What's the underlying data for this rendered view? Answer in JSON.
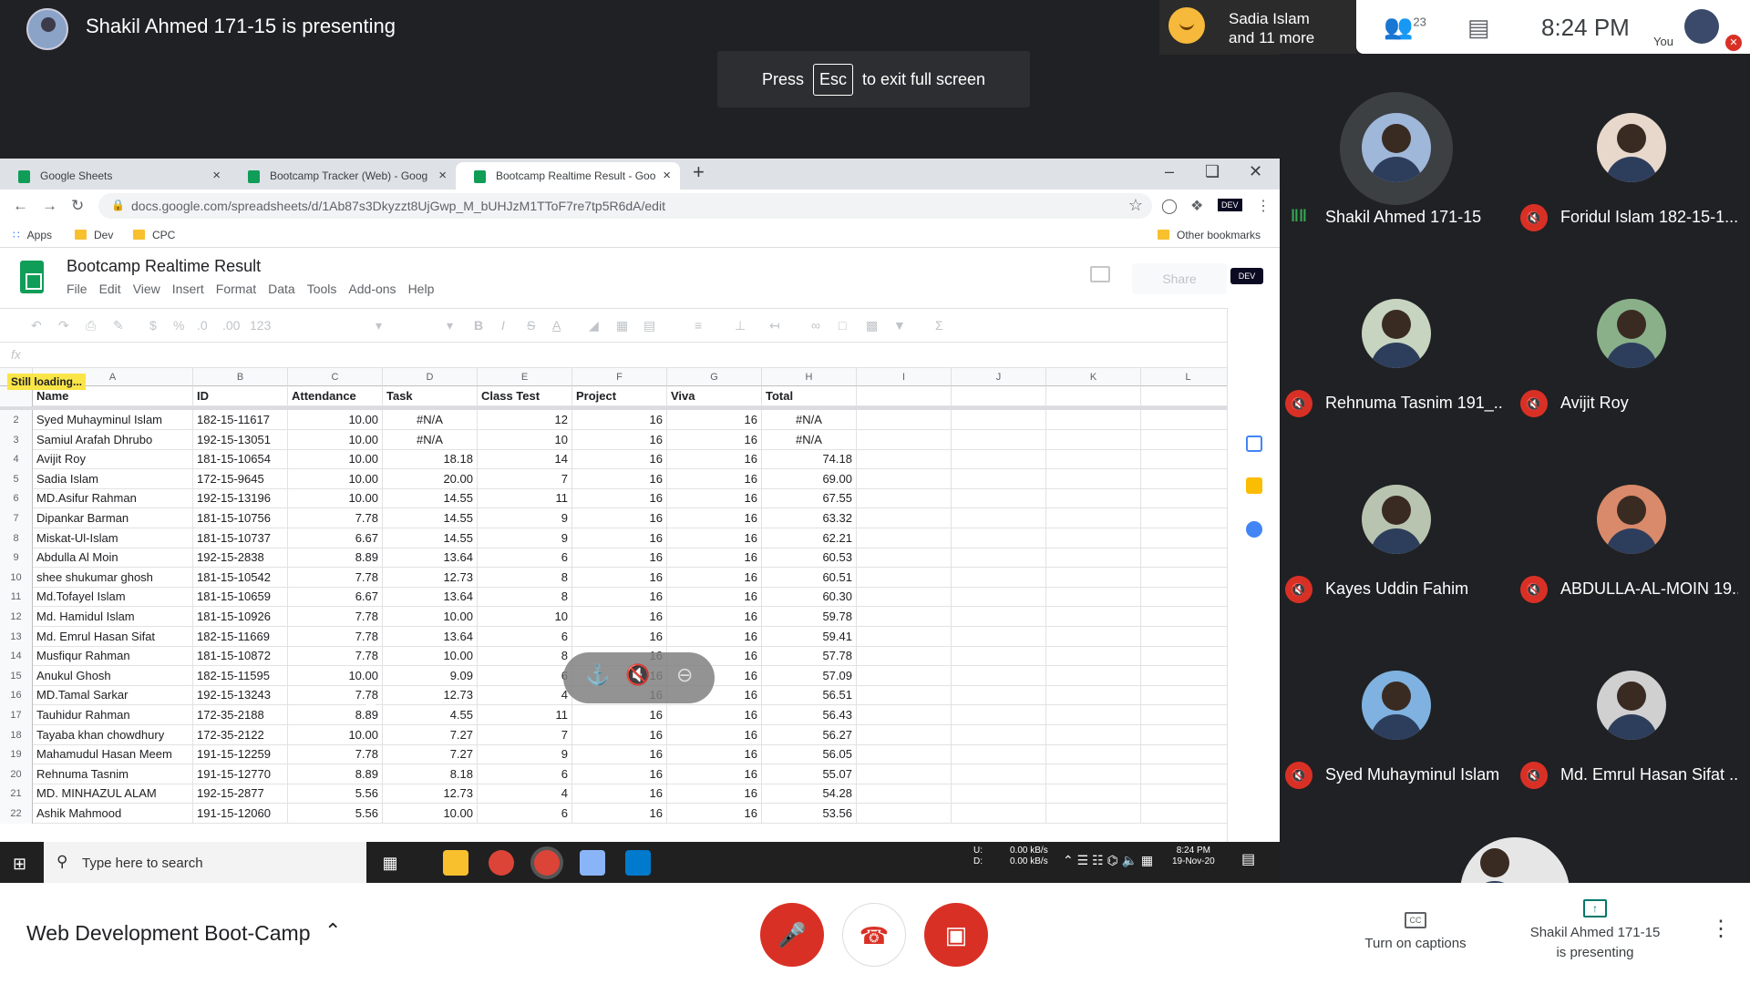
{
  "presenter": {
    "title": "Shakil Ahmed 171-15 is presenting"
  },
  "esc_toast": {
    "press": "Press",
    "key": "Esc",
    "suffix": "to exit full screen"
  },
  "speaker_pill": {
    "line1": "Sadia Islam",
    "line2": "and 11 more"
  },
  "meet_top": {
    "participant_count": "23",
    "clock": "8:24 PM",
    "you_label": "You"
  },
  "browser": {
    "tabs": [
      {
        "label": "Google Sheets"
      },
      {
        "label": "Bootcamp Tracker (Web) - Goog"
      },
      {
        "label": "Bootcamp Realtime Result - Goo"
      }
    ],
    "url": "docs.google.com/spreadsheets/d/1Ab87s3Dkyzzt8UjGwp_M_bUHJzM1TToF7re7tp5R6dA/edit",
    "bookmarks": [
      "Apps",
      "Dev",
      "CPC"
    ],
    "other_bookmarks": "Other bookmarks"
  },
  "sheet": {
    "title": "Bootcamp Realtime Result",
    "menu": [
      "File",
      "Edit",
      "View",
      "Insert",
      "Format",
      "Data",
      "Tools",
      "Add-ons",
      "Help"
    ],
    "share": "Share",
    "dev_badge": "DEV",
    "fx": "fx",
    "loading": "Still loading...",
    "toolbar_zoom": "123",
    "columns": [
      "A",
      "B",
      "C",
      "D",
      "E",
      "F",
      "G",
      "H",
      "I",
      "J",
      "K",
      "L"
    ],
    "headers": [
      "Name",
      "ID",
      "Attendance",
      "Task",
      "Class Test",
      "Project",
      "Viva",
      "Total"
    ],
    "rows": [
      [
        "2",
        "Syed Muhayminul Islam",
        "182-15-11617",
        "10.00",
        "#N/A",
        "12",
        "16",
        "16",
        "#N/A"
      ],
      [
        "3",
        "Samiul Arafah Dhrubo",
        "192-15-13051",
        "10.00",
        "#N/A",
        "10",
        "16",
        "16",
        "#N/A"
      ],
      [
        "4",
        "Avijit Roy",
        "181-15-10654",
        "10.00",
        "18.18",
        "14",
        "16",
        "16",
        "74.18"
      ],
      [
        "5",
        "Sadia Islam",
        "172-15-9645",
        "10.00",
        "20.00",
        "7",
        "16",
        "16",
        "69.00"
      ],
      [
        "6",
        "MD.Asifur Rahman",
        "192-15-13196",
        "10.00",
        "14.55",
        "11",
        "16",
        "16",
        "67.55"
      ],
      [
        "7",
        "Dipankar Barman",
        "181-15-10756",
        "7.78",
        "14.55",
        "9",
        "16",
        "16",
        "63.32"
      ],
      [
        "8",
        "Miskat-Ul-Islam",
        "181-15-10737",
        "6.67",
        "14.55",
        "9",
        "16",
        "16",
        "62.21"
      ],
      [
        "9",
        "Abdulla Al Moin",
        "192-15-2838",
        "8.89",
        "13.64",
        "6",
        "16",
        "16",
        "60.53"
      ],
      [
        "10",
        "shee shukumar ghosh",
        "181-15-10542",
        "7.78",
        "12.73",
        "8",
        "16",
        "16",
        "60.51"
      ],
      [
        "11",
        "Md.Tofayel Islam",
        "181-15-10659",
        "6.67",
        "13.64",
        "8",
        "16",
        "16",
        "60.30"
      ],
      [
        "12",
        "Md. Hamidul Islam",
        "181-15-10926",
        "7.78",
        "10.00",
        "10",
        "16",
        "16",
        "59.78"
      ],
      [
        "13",
        "Md. Emrul Hasan Sifat",
        "182-15-11669",
        "7.78",
        "13.64",
        "6",
        "16",
        "16",
        "59.41"
      ],
      [
        "14",
        "Musfiqur Rahman",
        "181-15-10872",
        "7.78",
        "10.00",
        "8",
        "16",
        "16",
        "57.78"
      ],
      [
        "15",
        "Anukul Ghosh",
        "182-15-11595",
        "10.00",
        "9.09",
        "6",
        "16",
        "16",
        "57.09"
      ],
      [
        "16",
        "MD.Tamal Sarkar",
        "192-15-13243",
        "7.78",
        "12.73",
        "4",
        "16",
        "16",
        "56.51"
      ],
      [
        "17",
        "Tauhidur Rahman",
        "172-35-2188",
        "8.89",
        "4.55",
        "11",
        "16",
        "16",
        "56.43"
      ],
      [
        "18",
        "Tayaba khan chowdhury",
        "172-35-2122",
        "10.00",
        "7.27",
        "7",
        "16",
        "16",
        "56.27"
      ],
      [
        "19",
        "Mahamudul Hasan Meem",
        "191-15-12259",
        "7.78",
        "7.27",
        "9",
        "16",
        "16",
        "56.05"
      ],
      [
        "20",
        "Rehnuma Tasnim",
        "191-15-12770",
        "8.89",
        "8.18",
        "6",
        "16",
        "16",
        "55.07"
      ],
      [
        "21",
        "MD. MINHAZUL ALAM",
        "192-15-2877",
        "5.56",
        "12.73",
        "4",
        "16",
        "16",
        "54.28"
      ],
      [
        "22",
        "Ashik Mahmood",
        "191-15-12060",
        "5.56",
        "10.00",
        "6",
        "16",
        "16",
        "53.56"
      ]
    ]
  },
  "taskbar": {
    "search_placeholder": "Type here to search",
    "net_up_label": "U:",
    "net_down_label": "D:",
    "net_up": "0.00 kB/s",
    "net_down": "0.00 kB/s",
    "time": "8:24 PM",
    "date": "19-Nov-20"
  },
  "participants": [
    {
      "name": "Shakil Ahmed 171-15",
      "muted": false
    },
    {
      "name": "Foridul Islam 182-15-1...",
      "muted": true
    },
    {
      "name": "Rehnuma Tasnim 191_...",
      "muted": true
    },
    {
      "name": "Avijit Roy",
      "muted": true
    },
    {
      "name": "Kayes Uddin Fahim",
      "muted": true
    },
    {
      "name": "ABDULLA-AL-MOIN 19...",
      "muted": true
    },
    {
      "name": "Syed Muhayminul Islam",
      "muted": true
    },
    {
      "name": "Md. Emrul Hasan Sifat ...",
      "muted": true
    }
  ],
  "bottom": {
    "meeting_name": "Web Development Boot-Camp",
    "captions": "Turn on captions",
    "presenting_line1": "Shakil Ahmed 171-15",
    "presenting_line2": "is presenting"
  },
  "colors": {
    "meet_red": "#d93025",
    "sheets_green": "#0f9d58",
    "meet_dark": "#202124"
  }
}
